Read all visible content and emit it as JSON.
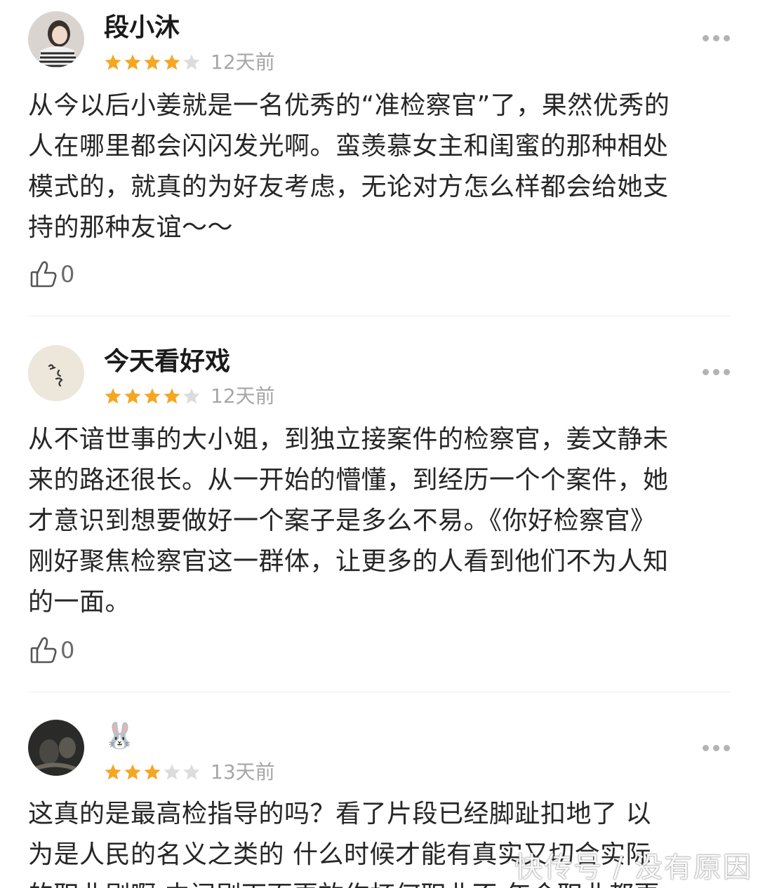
{
  "reviews": [
    {
      "username": "段小沐",
      "rating": 4,
      "time": "12天前",
      "content": "从今以后小姜就是一名优秀的“准检察官”了，果然优秀的\n人在哪里都会闪闪发光啊。蛮羡慕女主和闺蜜的那种相处\n模式的，就真的为好友考虑，无论对方怎么样都会给她支\n持的那种友谊～～",
      "likes": "0"
    },
    {
      "username": "今天看好戏",
      "rating": 4,
      "time": "12天前",
      "content": "从不谙世事的大小姐，到独立接案件的检察官，姜文静未\n来的路还很长。从一开始的懵懂，到经历一个个案件，她\n才意识到想要做好一个案子是多么不易。《你好检察官》\n刚好聚焦检察官这一群体，让更多的人看到他们不为人知\n的一面。",
      "likes": "0"
    },
    {
      "username": "🐰",
      "rating": 3,
      "time": "13天前",
      "content": "这真的是最高检指导的吗？看了片段已经脚趾扣地了 以\n为是人民的名义之类的 什么时候才能有真实又切合实际\n的职业剧啊 中间剧下面更放作杯何职业不 年令职业都更",
      "likes": ""
    }
  ],
  "watermark": "快传号 / 没有原因",
  "colors": {
    "star_filled": "#f5a623",
    "star_empty": "#dcdcdc"
  }
}
